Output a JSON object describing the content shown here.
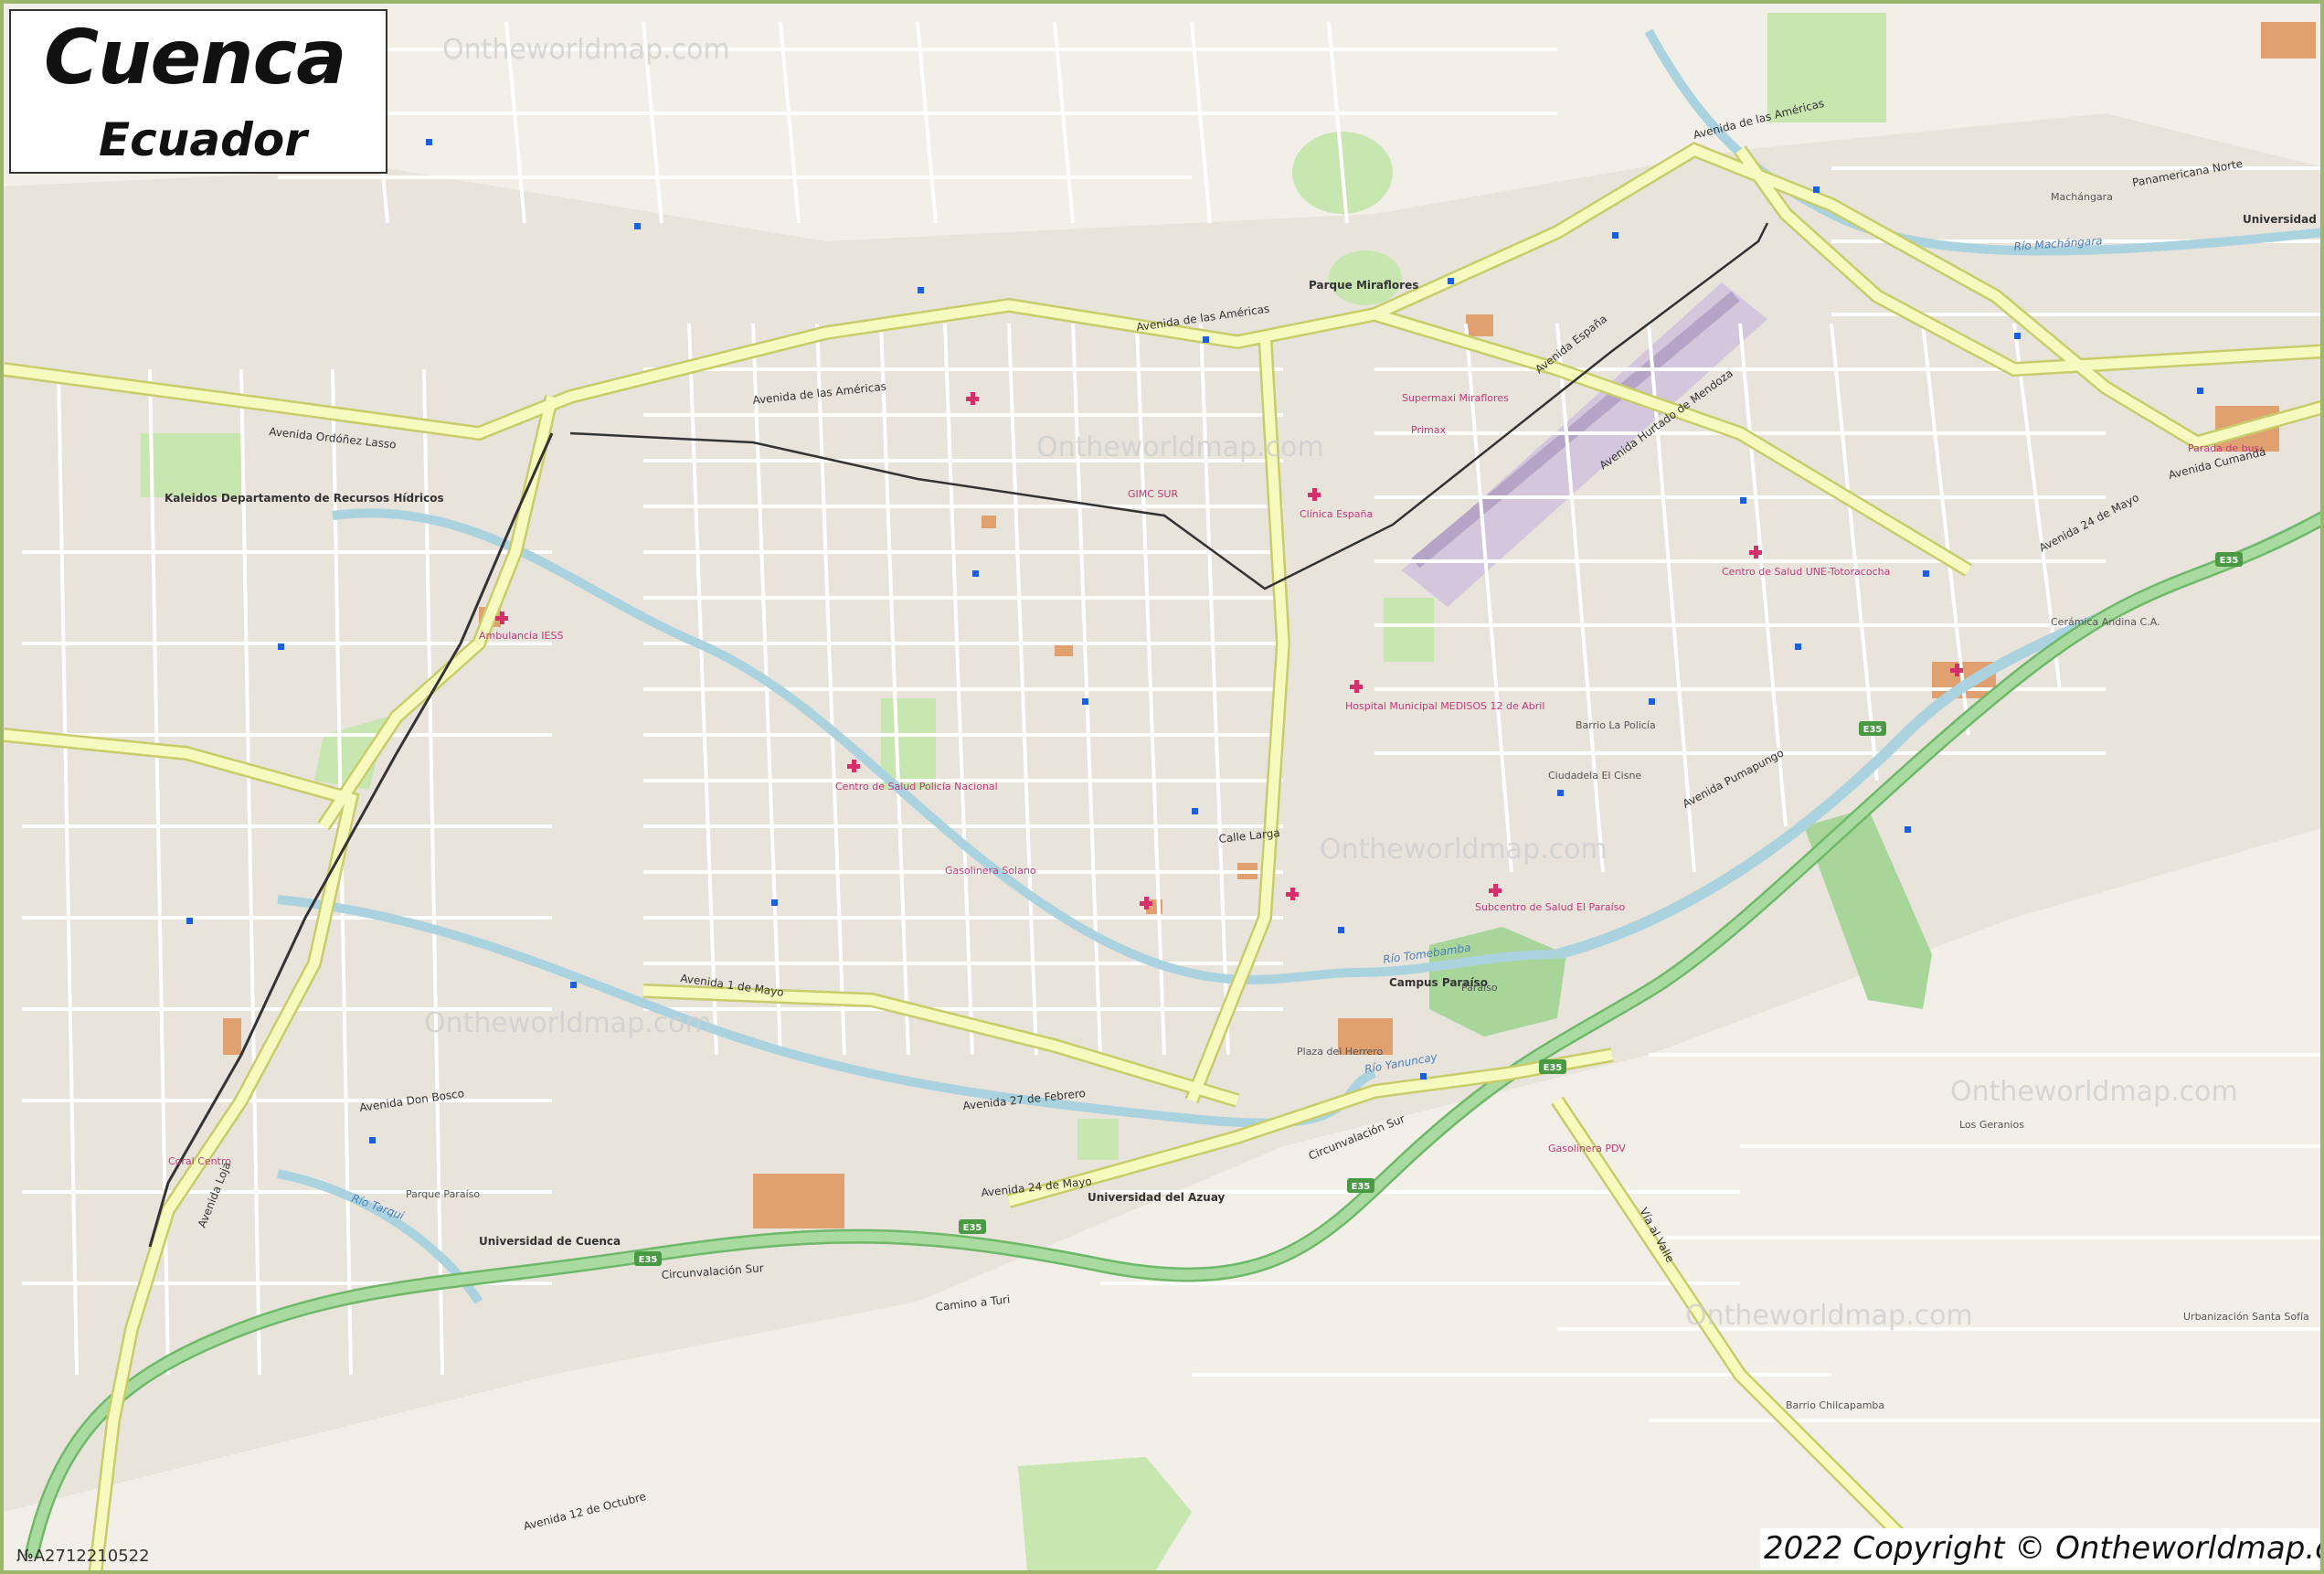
{
  "title": {
    "city": "Cuenca",
    "country": "Ecuador"
  },
  "map_code": "№A2712210522",
  "copyright": "2022 Copyright © Ontheworldmap.com",
  "watermark_text": "Ontheworldmap.com",
  "colors": {
    "land": "#f2efe9",
    "border": "#9bb86a",
    "primary_road": "#f7fabf",
    "primary_casing": "#c9cc6a",
    "trunk_road": "#a9dba0",
    "trunk_casing": "#6fb86a",
    "minor_road": "#ffffff",
    "river": "#aad3df",
    "river_line": "#6aa0d8",
    "park": "#c8e6b0",
    "forest": "#a8d59a",
    "building": "#e0a070",
    "railway": "#333333",
    "airport": "#d3c6dd",
    "bus_stop": "#1f5fd6",
    "hospital": "#d6306a"
  },
  "highways": [
    {
      "ref": "E35"
    }
  ],
  "roads": [
    {
      "name": "Avenida de las Américas"
    },
    {
      "name": "Avenida Ordóñez Lasso"
    },
    {
      "name": "Circunvalación Sur"
    },
    {
      "name": "Avenida 24 de Mayo"
    },
    {
      "name": "Avenida España"
    },
    {
      "name": "Avenida Hurtado de Mendoza"
    },
    {
      "name": "Avenida Pumapungo"
    },
    {
      "name": "Avenida Loja"
    },
    {
      "name": "Avenida Don Bosco"
    },
    {
      "name": "Avenida 1 de Mayo"
    },
    {
      "name": "Avenida 27 de Febrero"
    },
    {
      "name": "Avenida 12 de Octubre"
    },
    {
      "name": "Panamericana Norte"
    },
    {
      "name": "Calle Larga"
    },
    {
      "name": "Vía al Valle"
    },
    {
      "name": "Camino a Turi"
    },
    {
      "name": "Avenida Cumandá"
    }
  ],
  "rivers": [
    {
      "name": "Río Tomebamba"
    },
    {
      "name": "Río Yanuncay"
    },
    {
      "name": "Río Machángara"
    },
    {
      "name": "Río Tarqui"
    }
  ],
  "places": [
    {
      "name": "Parque Miraflores"
    },
    {
      "name": "Universidad de Cuenca"
    },
    {
      "name": "Universidad del Azuay"
    },
    {
      "name": "Universidad Católica"
    },
    {
      "name": "Campus Paraíso"
    },
    {
      "name": "Paraíso"
    },
    {
      "name": "Kaleidos Departamento de Recursos Hídricos"
    },
    {
      "name": "Cerámica Andina C.A."
    },
    {
      "name": "Barrio La Policía"
    },
    {
      "name": "Ciudadela El Cisne"
    },
    {
      "name": "Los Geranios"
    },
    {
      "name": "Barrio Chilcapamba"
    },
    {
      "name": "Gasolinera Solano"
    },
    {
      "name": "Gasolinera PDV"
    },
    {
      "name": "Plaza del Herrero"
    },
    {
      "name": "Parque Paraíso"
    },
    {
      "name": "Urbanización Santa Sofía"
    },
    {
      "name": "Machángara"
    }
  ],
  "pois": [
    {
      "name": "Clínica España"
    },
    {
      "name": "Hospital Municipal MEDISOS 12 de Abril"
    },
    {
      "name": "Centro de Salud Policía Nacional"
    },
    {
      "name": "Ambulancia IESS"
    },
    {
      "name": "Centro de Salud UNE-Totoracocha"
    },
    {
      "name": "Subcentro de Salud El Paraíso"
    },
    {
      "name": "Supermaxi Miraflores"
    },
    {
      "name": "Coral Centro"
    },
    {
      "name": "Parada de bus"
    },
    {
      "name": "GIMC SUR"
    },
    {
      "name": "Primax"
    }
  ]
}
